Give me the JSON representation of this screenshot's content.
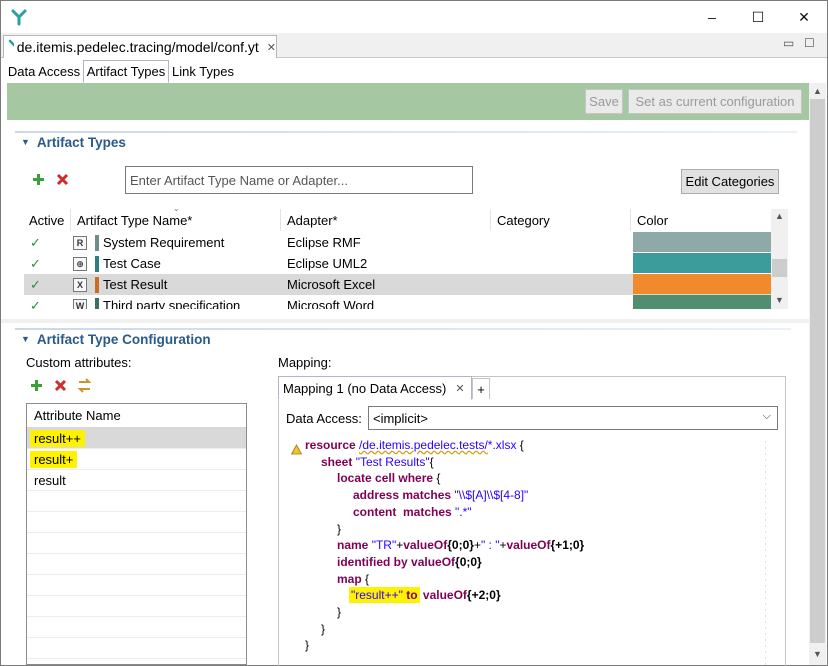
{
  "window": {
    "controls": {
      "minimize": "–",
      "maximize": "☐",
      "close": "✕"
    }
  },
  "editor_tab": {
    "title": "de.itemis.pedelec.tracing/model/conf.yt",
    "close": "✕"
  },
  "editor_controls": {
    "minimize": "▭",
    "maximize": "☐"
  },
  "subtabs": [
    "Data Access",
    "Artifact Types",
    "Link Types"
  ],
  "toolbar": {
    "save_label": "Save",
    "set_config_label": "Set as current configuration"
  },
  "artifact_types": {
    "section_title": "Artifact Types",
    "search_placeholder": "Enter Artifact Type Name or Adapter...",
    "edit_categories_label": "Edit Categories",
    "columns": [
      "Active",
      "Artifact Type Name*",
      "Adapter*",
      "Category",
      "Color"
    ],
    "rows": [
      {
        "active": "✓",
        "icon": "R",
        "name": "System Requirement",
        "adapter": "Eclipse RMF",
        "category": "",
        "color": "#8fa9a9",
        "marker": "#6b8f8f"
      },
      {
        "active": "✓",
        "icon": "⊕",
        "name": "Test Case",
        "adapter": "Eclipse UML2",
        "category": "",
        "color": "#3c9b9b",
        "marker": "#2f7f7f"
      },
      {
        "active": "✓",
        "icon": "X",
        "name": "Test Result",
        "adapter": "Microsoft Excel",
        "category": "",
        "color": "#f08a2c",
        "marker": "#c96e1f"
      },
      {
        "active": "✓",
        "icon": "W",
        "name": "Third party specification",
        "adapter": "Microsoft Word",
        "category": "",
        "color": "#4f8f6f",
        "marker": "#3f6f5f"
      }
    ]
  },
  "config": {
    "section_title": "Artifact Type Configuration",
    "custom_attributes_label": "Custom attributes:",
    "mapping_label": "Mapping:",
    "attribute_header": "Attribute Name",
    "attributes": [
      "result++",
      "result+",
      "result"
    ],
    "mapping_tab_label": "Mapping 1 (no Data Access)",
    "mapping_add_tab": "+",
    "data_access_label": "Data Access:",
    "data_access_value": "<implicit>",
    "code": {
      "l1_kw": "resource",
      "l1_path": "/de.itemis.pedelec.tests/",
      "l1_glob": "*.xlsx",
      "l1_end": " {",
      "l2_kw": "sheet",
      "l2_str": "\"Test Results\"",
      "l2_end": "{",
      "l3_kw": "locate cell where",
      "l3_end": " {",
      "l4_kw": "address matches",
      "l4_str": "\"\\\\$[A]\\\\$[4-8]\"",
      "l5_kw": "content  matches",
      "l5_str": "\".*\"",
      "l6": "}",
      "l7_kw": "name",
      "l7_str1": "\"TR\"",
      "l7_op": "+",
      "l7_fn": "valueOf",
      "l7_a1": "{0;0}",
      "l7_op2": "+",
      "l7_str2": "\" : \"",
      "l7_op3": "+",
      "l7_fn2": "valueOf",
      "l7_a2": "{+1;0}",
      "l8_kw": "identified by",
      "l8_fn": "valueOf",
      "l8_a": "{0;0}",
      "l9_kw": "map",
      "l9_end": " {",
      "l10_str": "\"result++\"",
      "l10_kw": "to",
      "l10_fn": "valueOf",
      "l10_a": "{+2;0}",
      "l11": "}",
      "l12": "}",
      "l13": "}"
    }
  },
  "colors": {
    "accent": "#2a5a8a",
    "green_bar": "#a5c8a2",
    "highlight": "#fff200"
  }
}
